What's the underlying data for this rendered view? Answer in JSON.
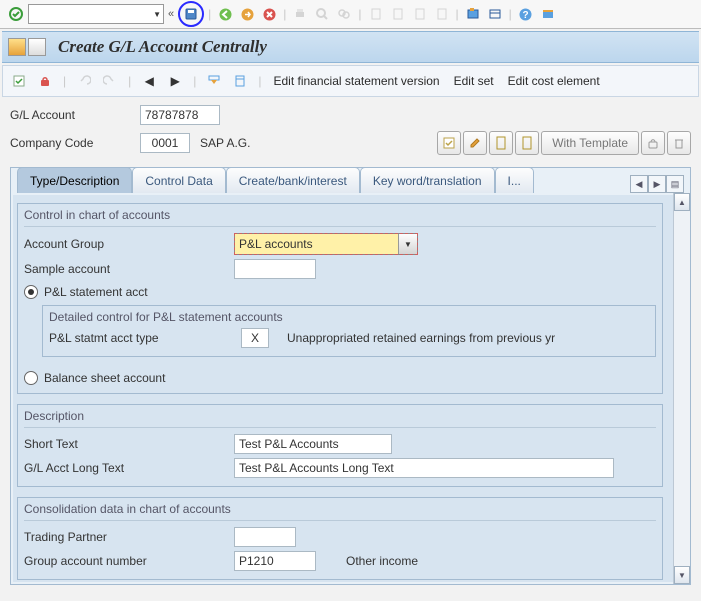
{
  "title": "Create G/L Account Centrally",
  "subToolbar": {
    "link1": "Edit financial statement version",
    "link2": "Edit set",
    "link3": "Edit cost element"
  },
  "header": {
    "glAccount": {
      "label": "G/L Account",
      "value": "78787878"
    },
    "companyCode": {
      "label": "Company Code",
      "value": "0001",
      "desc": "SAP A.G."
    },
    "withTemplateLabel": "With Template"
  },
  "tabs": {
    "t1": "Type/Description",
    "t2": "Control Data",
    "t3": "Create/bank/interest",
    "t4": "Key word/translation",
    "t5": "I..."
  },
  "controlGroup": {
    "title": "Control in chart of accounts",
    "accountGroup": {
      "label": "Account Group",
      "value": "P&L accounts"
    },
    "sampleAccount": {
      "label": "Sample account",
      "value": ""
    },
    "plStatement": {
      "label": "P&L statement acct"
    },
    "detail": {
      "title": "Detailed control for P&L statement accounts",
      "plType": {
        "label": "P&L statmt acct type",
        "value": "X",
        "desc": "Unappropriated retained earnings from previous yr"
      }
    },
    "balanceSheet": {
      "label": "Balance sheet account"
    }
  },
  "descriptionGroup": {
    "title": "Description",
    "shortText": {
      "label": "Short Text",
      "value": "Test P&L Accounts"
    },
    "longText": {
      "label": "G/L Acct Long Text",
      "value": "Test P&L Accounts Long Text"
    }
  },
  "consolidationGroup": {
    "title": "Consolidation data in chart of accounts",
    "tradingPartner": {
      "label": "Trading Partner",
      "value": ""
    },
    "groupAcct": {
      "label": "Group account number",
      "value": "P1210",
      "desc": "Other income"
    }
  }
}
